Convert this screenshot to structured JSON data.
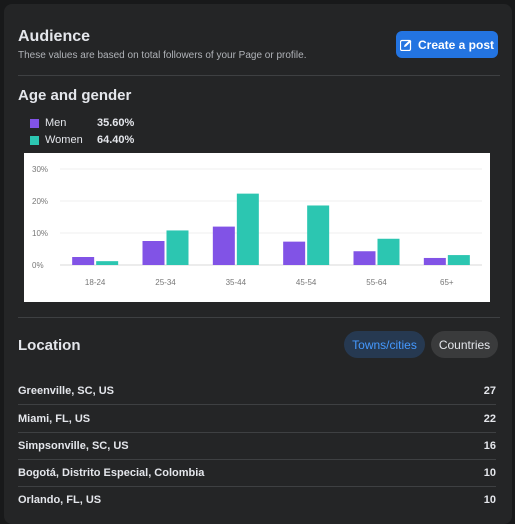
{
  "audience": {
    "title": "Audience",
    "subtitle": "These values are based on total followers of your Page or profile.",
    "create_post_label": "Create a post"
  },
  "age_gender": {
    "title": "Age and gender",
    "legend": [
      {
        "label": "Men",
        "percent": "35.60%",
        "color": "#8153e6"
      },
      {
        "label": "Women",
        "percent": "64.40%",
        "color": "#2cc6b1"
      }
    ]
  },
  "chart_data": {
    "type": "bar",
    "categories": [
      "18-24",
      "25-34",
      "35-44",
      "45-54",
      "55-64",
      "65+"
    ],
    "series": [
      {
        "name": "Men",
        "values": [
          2.5,
          7.5,
          12,
          7.3,
          4.3,
          2.2
        ]
      },
      {
        "name": "Women",
        "values": [
          1.2,
          10.8,
          22.3,
          18.6,
          8.2,
          3.1
        ]
      }
    ],
    "y_ticks": [
      "0%",
      "10%",
      "20%",
      "30%"
    ],
    "ylim": [
      0,
      30
    ],
    "grid": true
  },
  "location": {
    "title": "Location",
    "tabs": [
      {
        "label": "Towns/cities",
        "active": true
      },
      {
        "label": "Countries",
        "active": false
      }
    ],
    "rows": [
      {
        "name": "Greenville, SC, US",
        "count": "27"
      },
      {
        "name": "Miami, FL, US",
        "count": "22"
      },
      {
        "name": "Simpsonville, SC, US",
        "count": "16"
      },
      {
        "name": "Bogotá, Distrito Especial, Colombia",
        "count": "10"
      },
      {
        "name": "Orlando, FL, US",
        "count": "10"
      }
    ]
  }
}
